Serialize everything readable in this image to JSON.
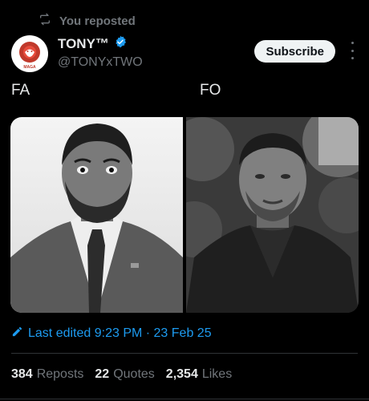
{
  "repost": {
    "text": "You reposted",
    "icon": "repost-icon"
  },
  "author": {
    "name": "TONY™",
    "handle": "@TONYxTWO",
    "verified_icon": "verified-badge-icon",
    "avatar_text": "MAGA"
  },
  "subscribe_label": "Subscribe",
  "post": {
    "left_text": "FA",
    "right_text": "FO"
  },
  "media": [
    {
      "name": "photo-left"
    },
    {
      "name": "photo-right"
    }
  ],
  "edited": {
    "label": "Last edited 9:23 PM · 23 Feb 25",
    "icon": "pencil-icon"
  },
  "stats": {
    "reposts": {
      "num": "384",
      "label": "Reposts"
    },
    "quotes": {
      "num": "22",
      "label": "Quotes"
    },
    "likes": {
      "num": "2,354",
      "label": "Likes"
    }
  },
  "colors": {
    "accent": "#1d9bf0",
    "background": "#000000",
    "muted": "#71767b",
    "text": "#e7e9ea"
  }
}
